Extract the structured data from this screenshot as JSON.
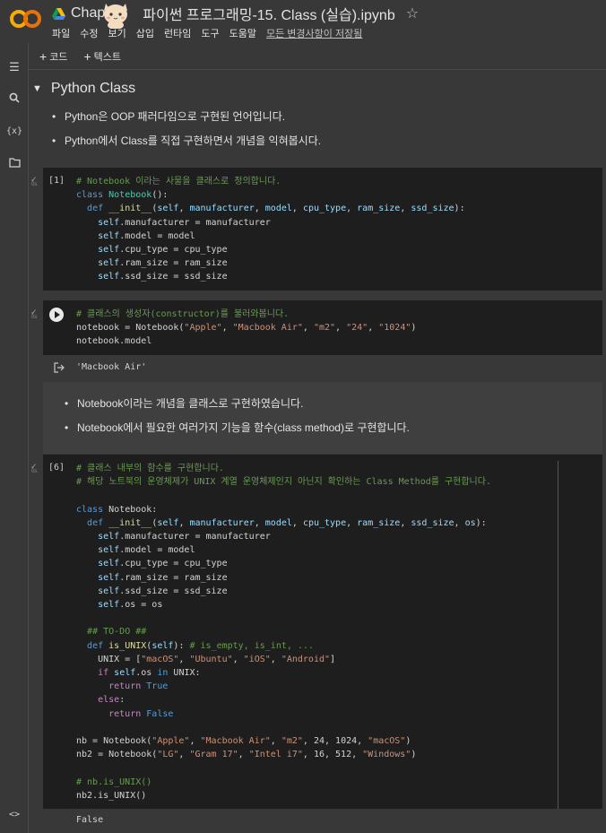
{
  "header": {
    "logo_text": "CO",
    "title": "Chapter 02. 파이썬 프로그래밍-15. Class (실습).ipynb",
    "title_visible": "Chap",
    "title_rest": "파이썬 프로그래밍-15. Class (실습).ipynb",
    "menu": [
      "파일",
      "수정",
      "보기",
      "삽입",
      "런타임",
      "도구",
      "도움말"
    ],
    "saved_status": "모든 변경사항이 저장됨",
    "colors": {
      "logo_orange": "#f9ab00",
      "logo_yellow": "#e8710a"
    }
  },
  "leftbar": {
    "icons": [
      "toc-icon",
      "search-icon",
      "variables-icon",
      "folder-icon",
      "code-snippets-icon"
    ],
    "variables_label": "{x}",
    "code_label": "<>"
  },
  "toolbar": {
    "add_code_label": "코드",
    "add_text_label": "텍스트"
  },
  "section": {
    "title": "Python Class",
    "bullets": [
      "Python은 OOP 패러다임으로 구현된 언어입니다.",
      "Python에서 Class를 직접 구현하면서 개념을 익혀봅시다."
    ]
  },
  "cells": {
    "cell1": {
      "exec_count": "[1]",
      "status": "✓",
      "duration": "0s"
    },
    "cell2": {
      "status": "✓",
      "duration": "0s",
      "output": "'Macbook Air'"
    },
    "text_bullets": [
      "Notebook이라는 개념을 클래스로 구현하였습니다.",
      "Notebook에서 필요한 여러가지 기능을 함수(class method)로 구현합니다."
    ],
    "cell3": {
      "exec_count": "[6]",
      "status": "✓",
      "duration": "0s",
      "output": "False"
    }
  }
}
